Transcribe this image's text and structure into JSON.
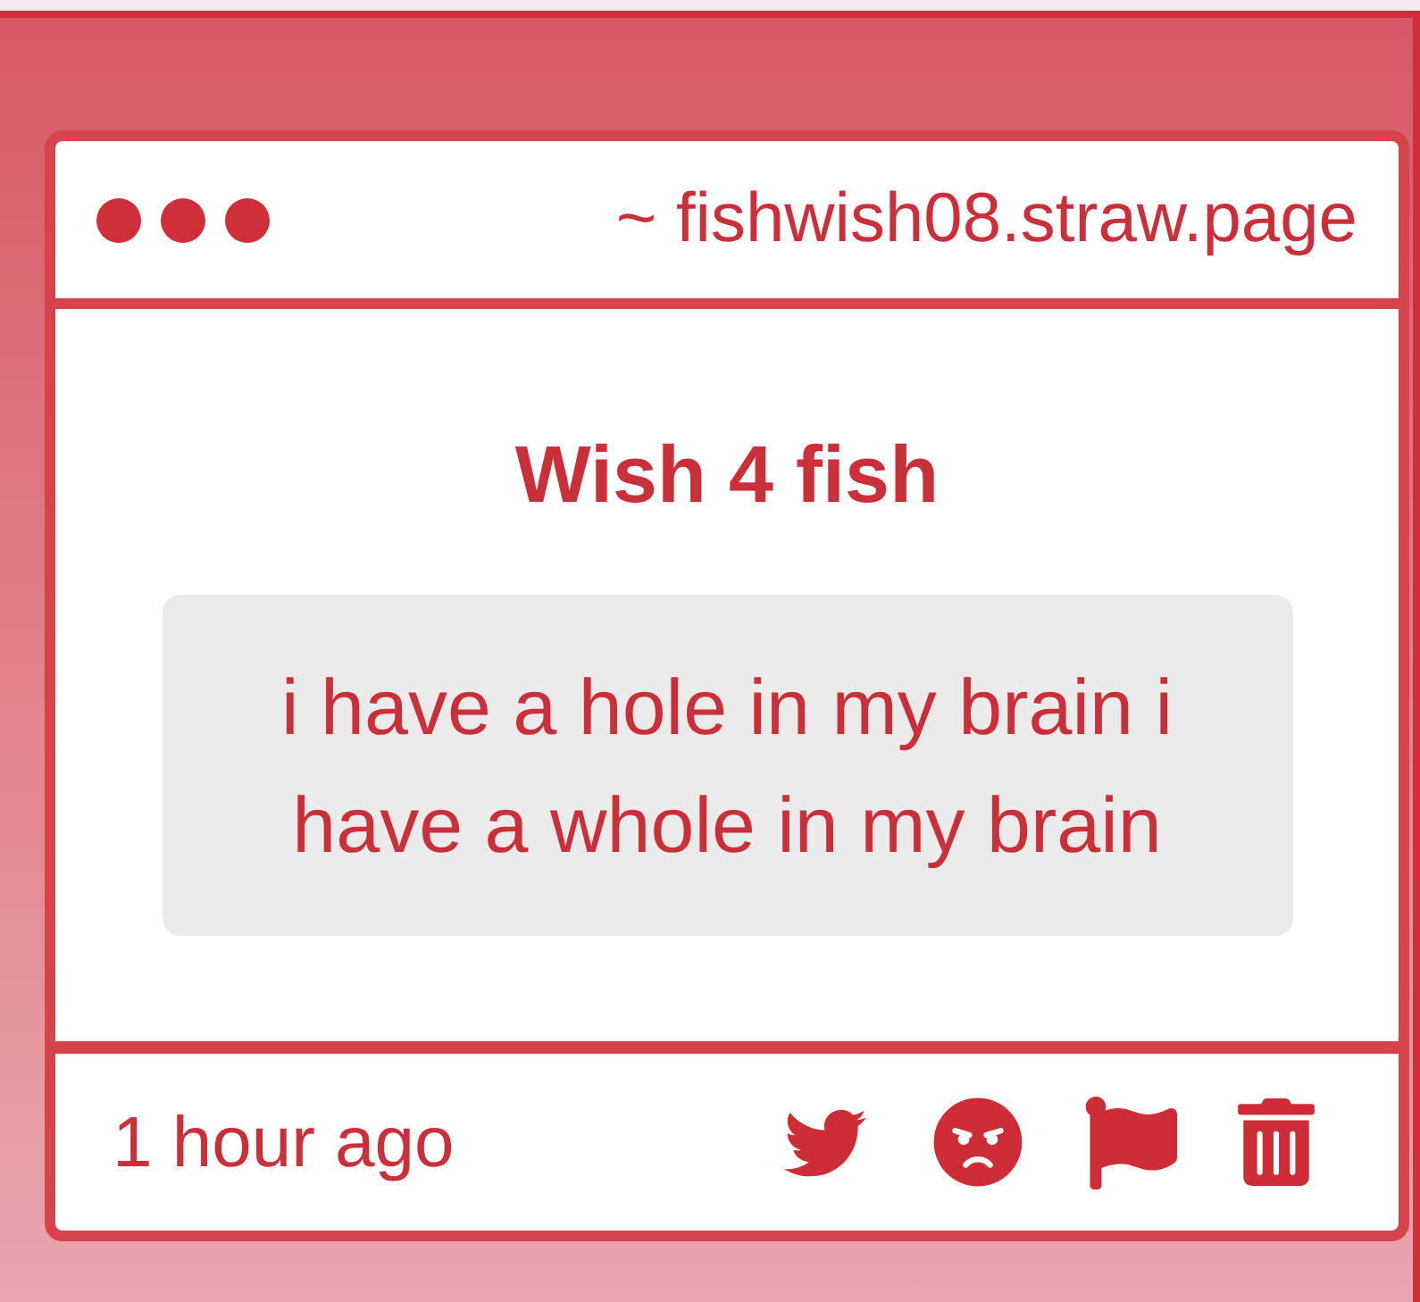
{
  "window": {
    "url": "~ fishwish08.straw.page"
  },
  "post": {
    "title": "Wish 4 fish",
    "body": "i have a hole in my brain i have a whole in my brain"
  },
  "footer": {
    "time": "1 hour ago",
    "actions": [
      {
        "kind": "twitter"
      },
      {
        "kind": "react"
      },
      {
        "kind": "flag"
      },
      {
        "kind": "delete"
      }
    ]
  }
}
